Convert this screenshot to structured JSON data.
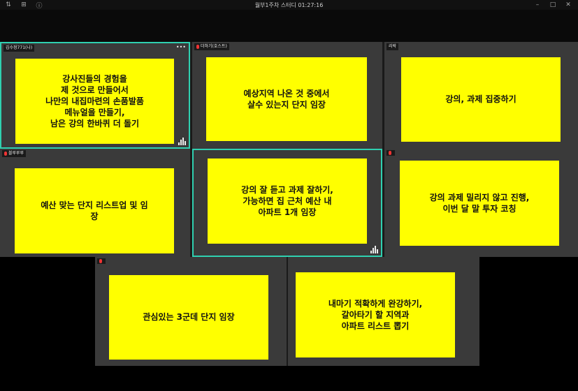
{
  "window": {
    "title": "월부1주차 스터디 01:27:16",
    "left_icons": [
      "⇅",
      "⊞",
      "ⓘ"
    ],
    "controls": [
      "–",
      "□",
      "✕"
    ]
  },
  "tiles": [
    {
      "name": "김수정771(나)",
      "note": "강사진들의 경험을\n제 것으로 만들어서\n나만의 내집마련의 손품발품\n메뉴얼을 만들기,\n남은 강의 한바퀴 더 돌기"
    },
    {
      "name": "더하기(호스트)",
      "note": "예상지역 나온 것 중에서\n살수 있는지 단지 임장"
    },
    {
      "name": "리락",
      "note": "강의, 과제 집중하기"
    },
    {
      "name": "블루루루",
      "note": "예산 맞는 단지 리스트업 및 임\n장"
    },
    {
      "name": "",
      "note": "강의 잘 듣고 과제 잘하기,\n가능하면 집 근처 예산 내\n아파트 1개 임장"
    },
    {
      "name": "",
      "note": "강의 과제 밀리지 않고 진행,\n이번 달 말 투자 코칭"
    },
    {
      "name": "",
      "note": "관심있는 3군데 단지 임장"
    },
    {
      "name": "",
      "note": "내마기 적확하게 완강하기,\n갈아타기 할 지역과\n아파트 리스트 뽑기"
    }
  ],
  "more_label": "•••"
}
